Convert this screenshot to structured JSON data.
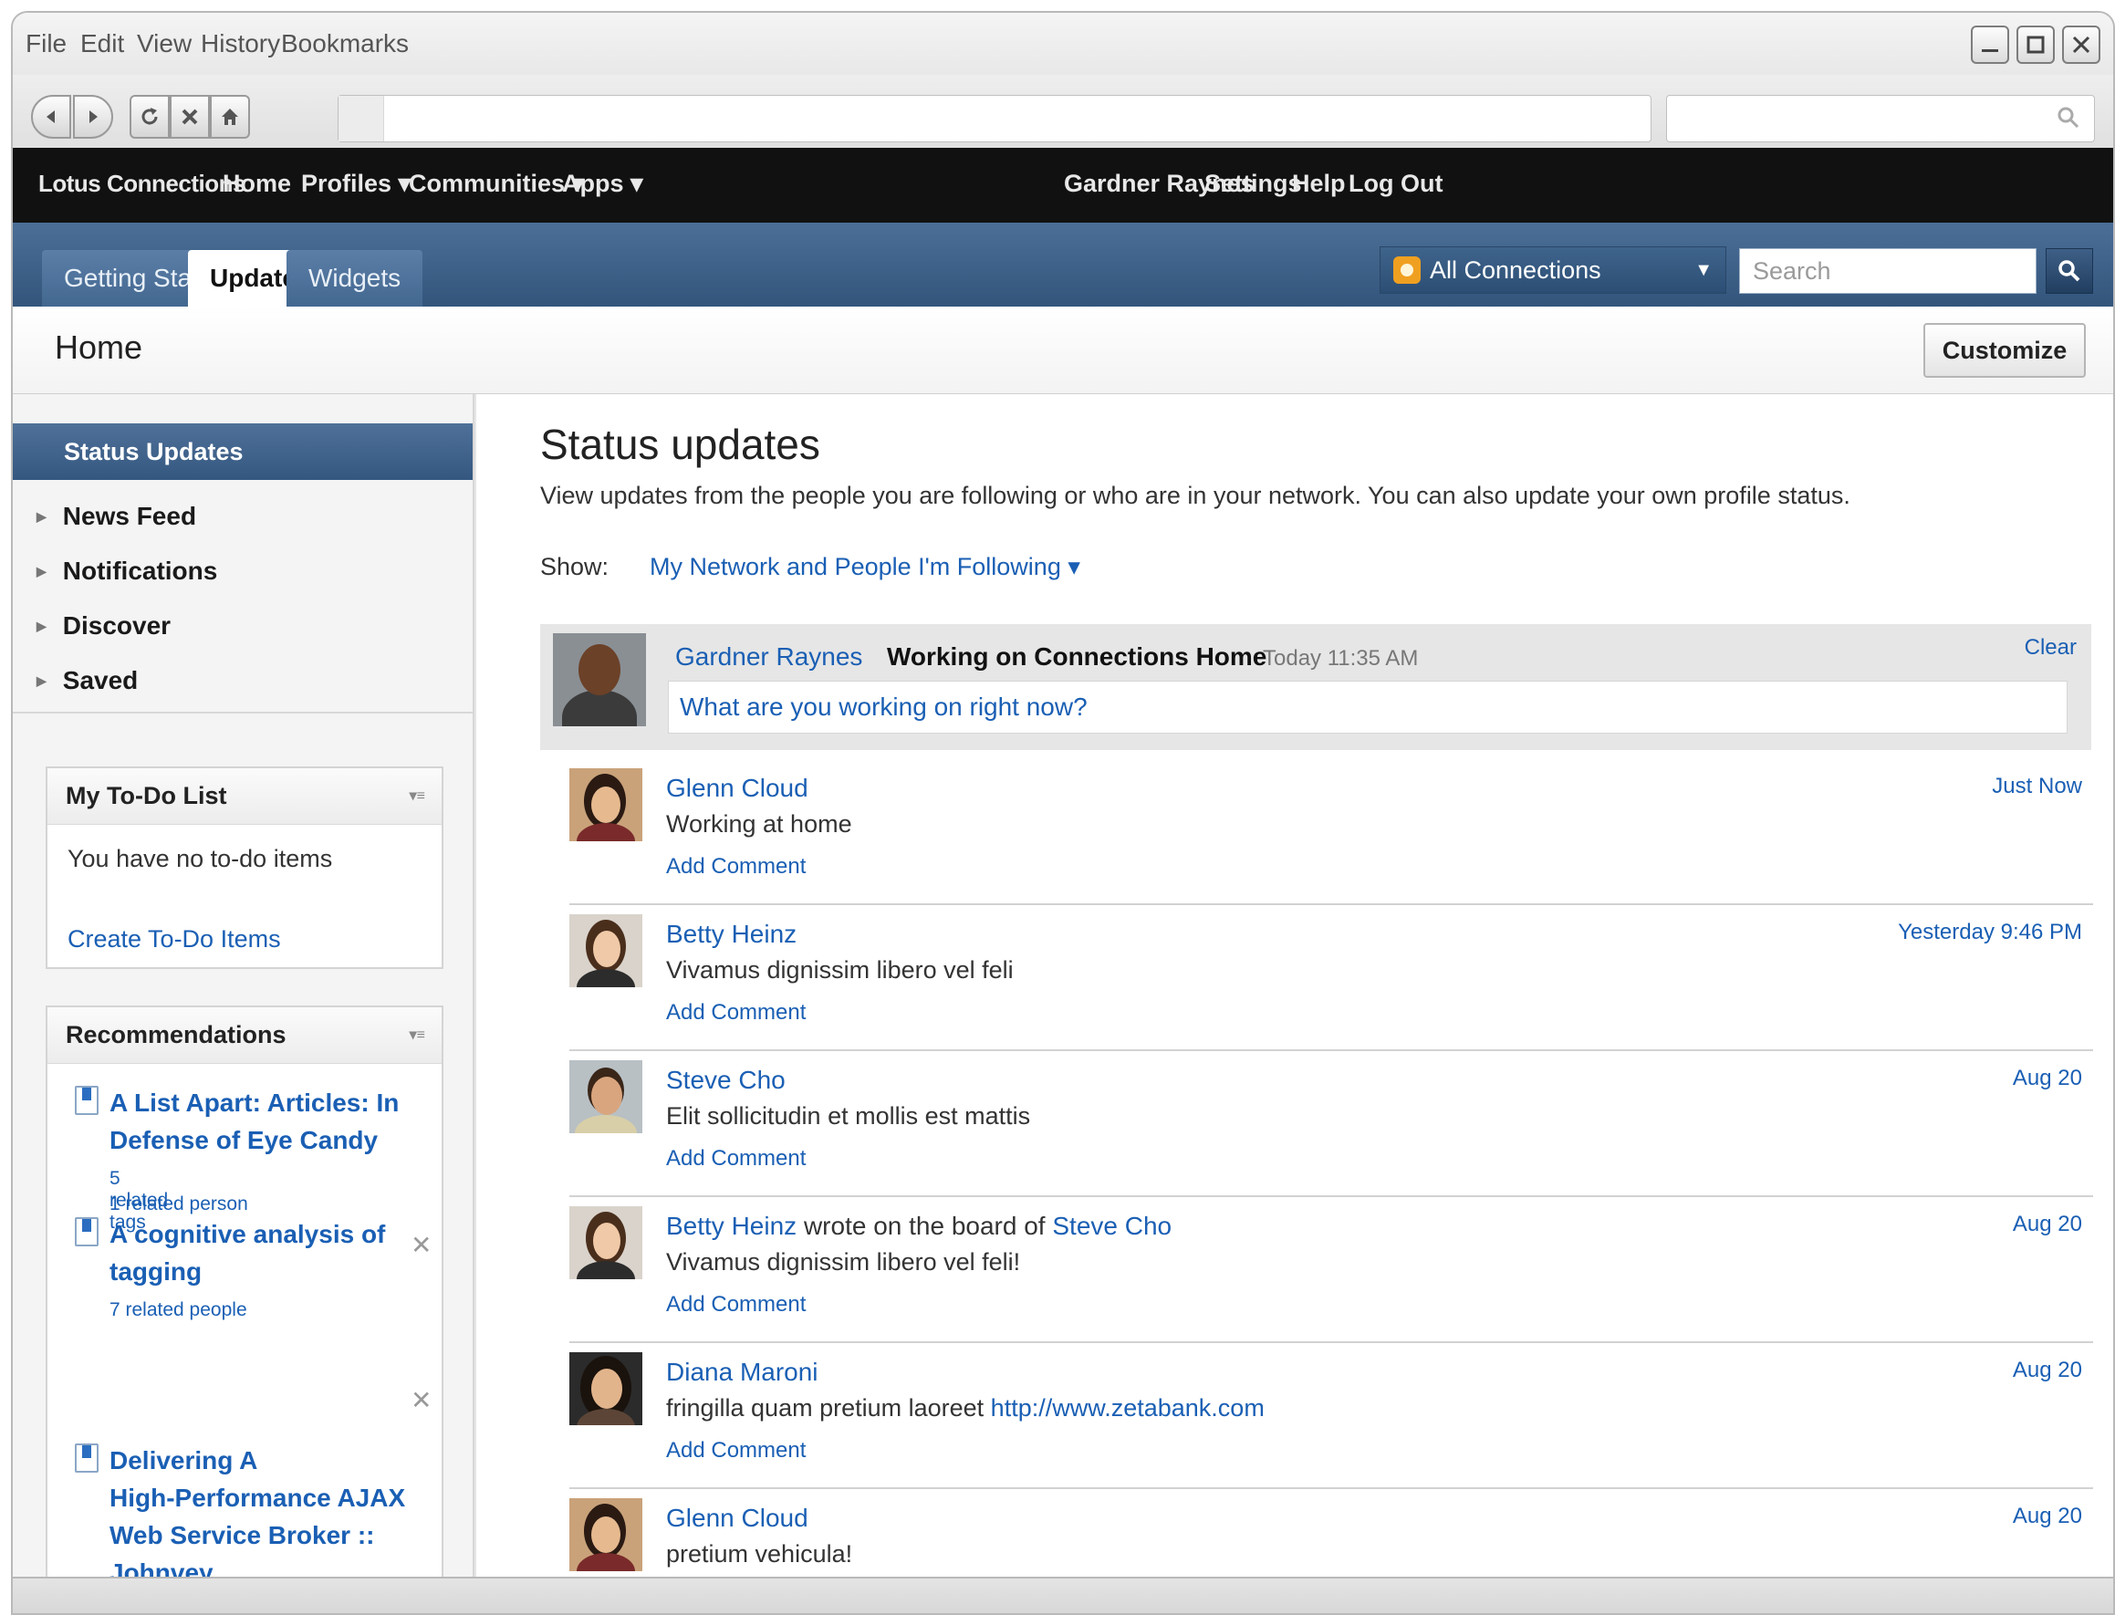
{
  "browser": {
    "menu": [
      "File",
      "Edit",
      "View",
      "History",
      "Bookmarks"
    ],
    "address_value": "",
    "search_value": ""
  },
  "header": {
    "brand": "Lotus Connections",
    "nav": [
      "Home",
      "Profiles ▾",
      "Communities ▾",
      "Apps ▾"
    ],
    "user_links": [
      "Gardner Raynes",
      "Settings",
      "Help",
      "Log Out"
    ]
  },
  "tabs": [
    "Getting Started",
    "Updates",
    "Widgets"
  ],
  "scope": {
    "label": "All Connections"
  },
  "app_search": {
    "placeholder": "Search"
  },
  "page": {
    "title": "Home",
    "customize_label": "Customize"
  },
  "sidebar": {
    "active": "Status Updates",
    "items": [
      "News Feed",
      "Notifications",
      "Discover",
      "Saved"
    ]
  },
  "todo": {
    "title": "My To-Do List",
    "empty_text": "You have no to-do items",
    "create_label": "Create To-Do Items"
  },
  "recommendations": {
    "title": "Recommendations",
    "items": [
      {
        "title_lines": [
          "A List Apart: Articles: In",
          "Defense of Eye Candy"
        ],
        "meta": [
          "5 related tags",
          "1 related person"
        ]
      },
      {
        "title_lines": [
          "A cognitive analysis of",
          "tagging"
        ],
        "meta": [
          "7 related people"
        ]
      },
      {
        "title_lines": [
          "Delivering A",
          "High-Performance AJAX",
          "Web Service Broker ::",
          "Johnvey"
        ],
        "meta": []
      }
    ]
  },
  "main": {
    "title": "Status updates",
    "description": "View updates from the people you are following or who are in your network. You can also update your own profile status.",
    "show_label": "Show:",
    "show_value": "My Network and People I'm Following ▾"
  },
  "my_status": {
    "name": "Gardner Raynes",
    "status": "Working on Connections Home",
    "time": "Today 11:35 AM",
    "clear_label": "Clear",
    "input_placeholder": "What are you working on right now?"
  },
  "add_comment_label": "Add Comment",
  "updates": [
    {
      "name": "Glenn Cloud",
      "text": "Working at home",
      "time": "Just Now"
    },
    {
      "name": "Betty Heinz",
      "text": "Vivamus dignissim libero vel feli",
      "time": "Yesterday 9:46 PM"
    },
    {
      "name": "Steve Cho",
      "text": "Elit sollicitudin et mollis est mattis",
      "time": "Aug 20"
    },
    {
      "name": "Betty Heinz",
      "middle": " wrote on the board of ",
      "target": "Steve Cho",
      "text": "Vivamus dignissim libero vel feli!",
      "time": "Aug 20"
    },
    {
      "name": "Diana Maroni",
      "text": "fringilla quam pretium laoreet ",
      "link": "http://www.zetabank.com",
      "time": "Aug 20"
    },
    {
      "name": "Glenn Cloud",
      "text": "pretium vehicula!",
      "time": "Aug 20"
    }
  ]
}
